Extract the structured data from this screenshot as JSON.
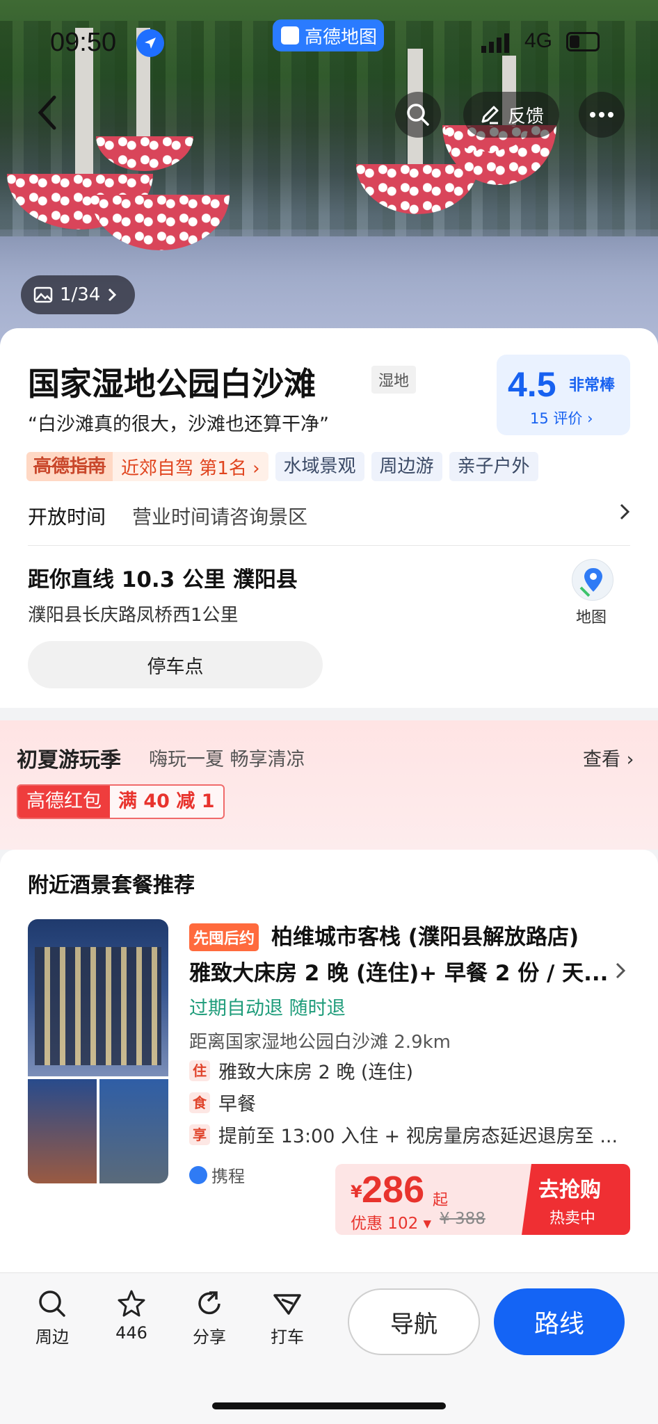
{
  "status_bar": {
    "time": "09:50",
    "network": "4G",
    "app_pill": "高德地图"
  },
  "header": {
    "feedback_label": "反馈",
    "photo_counter": "1/34"
  },
  "poi": {
    "name": "国家湿地公园白沙滩",
    "category": "湿地",
    "quote": "“白沙滩真的很大，沙滩也还算干净”",
    "rating": {
      "score": "4.5",
      "label": "非常棒",
      "count": "15 评价"
    },
    "guide_badge": "高德指南",
    "guide_rank": "近郊自驾 第1名",
    "tags": [
      "水域景观",
      "周边游",
      "亲子户外"
    ],
    "hours_label": "开放时间",
    "hours_value": "营业时间请咨询景区",
    "distance": "距你直线 10.3 公里  濮阳县",
    "address": "濮阳县长庆路凤桥西1公里",
    "map_label": "地图",
    "parking_label": "停车点"
  },
  "promo": {
    "title": "初夏游玩季",
    "subtitle": "嗨玩一夏 畅享清凉",
    "more": "查看",
    "coupon_name": "高德红包",
    "coupon_value": "满 40 减 1"
  },
  "hotel_section": {
    "title": "附近酒景套餐推荐",
    "badge": "先囤后约",
    "name": "柏维城市客栈 (濮阳县解放路店)",
    "room": "雅致大床房 2 晚 (连住)+ 早餐 2 份 / 天...",
    "refund": "过期自动退 随时退",
    "distance": "距离国家湿地公园白沙滩 2.9km",
    "perks": [
      {
        "key": "住",
        "text": "雅致大床房 2 晚 (连住)"
      },
      {
        "key": "食",
        "text": "早餐"
      },
      {
        "key": "享",
        "text": "提前至 13:00 入住 + 视房量房态延迟退房至 ..."
      }
    ],
    "provider": "携程",
    "currency": "¥",
    "price": "286",
    "price_suffix": "起",
    "discount": "优惠 102",
    "original_price": "¥ 388",
    "buy_label": "去抢购",
    "buy_sub": "热卖中"
  },
  "tabbar": {
    "nearby": "周边",
    "favorites": "446",
    "share": "分享",
    "taxi": "打车",
    "navigate": "导航",
    "route": "路线"
  }
}
